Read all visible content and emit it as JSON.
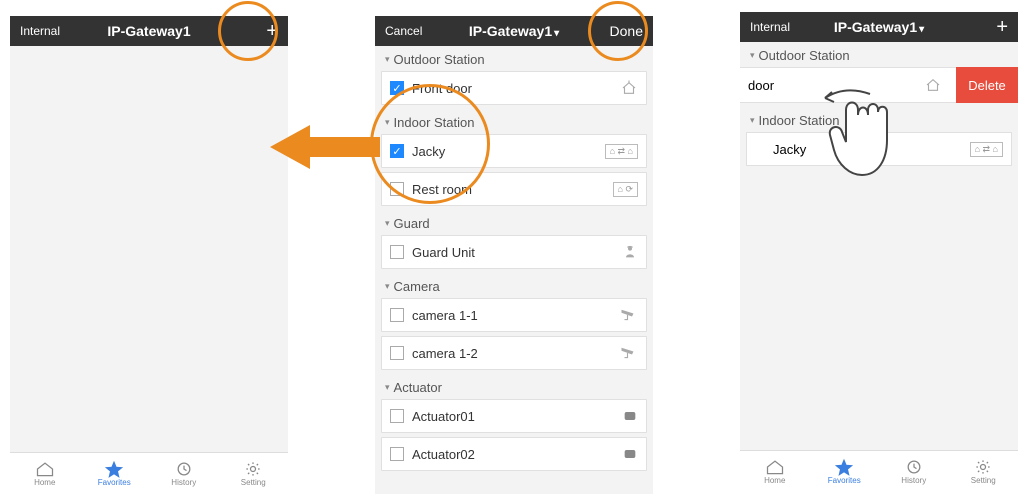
{
  "phone1": {
    "nav_left": "Internal",
    "nav_title": "IP-Gateway1",
    "tabbar": [
      "Home",
      "Favorites",
      "History",
      "Setting"
    ]
  },
  "phone2": {
    "nav_left": "Cancel",
    "nav_title": "IP-Gateway1",
    "nav_right": "Done",
    "sections": [
      {
        "title": "Outdoor Station",
        "items": [
          {
            "label": "Front door",
            "checked": true,
            "icon": "house"
          }
        ]
      },
      {
        "title": "Indoor Station",
        "items": [
          {
            "label": "Jacky",
            "checked": true,
            "icon": "house-link"
          },
          {
            "label": "Rest room",
            "checked": false,
            "icon": "house-refresh"
          }
        ]
      },
      {
        "title": "Guard",
        "items": [
          {
            "label": "Guard Unit",
            "checked": false,
            "icon": "guard"
          }
        ]
      },
      {
        "title": "Camera",
        "items": [
          {
            "label": "camera 1-1",
            "checked": false,
            "icon": "camera"
          },
          {
            "label": "camera 1-2",
            "checked": false,
            "icon": "camera"
          }
        ]
      },
      {
        "title": "Actuator",
        "items": [
          {
            "label": "Actuator01",
            "checked": false,
            "icon": "actuator"
          },
          {
            "label": "Actuator02",
            "checked": false,
            "icon": "actuator"
          }
        ]
      }
    ]
  },
  "phone3": {
    "nav_left": "Internal",
    "nav_title": "IP-Gateway1",
    "sections": {
      "outdoor_title": "Outdoor Station",
      "swipe_label": "door",
      "delete_label": "Delete",
      "indoor_title": "Indoor Station",
      "indoor_item": "Jacky"
    },
    "tabbar": [
      "Home",
      "Favorites",
      "History",
      "Setting"
    ]
  }
}
